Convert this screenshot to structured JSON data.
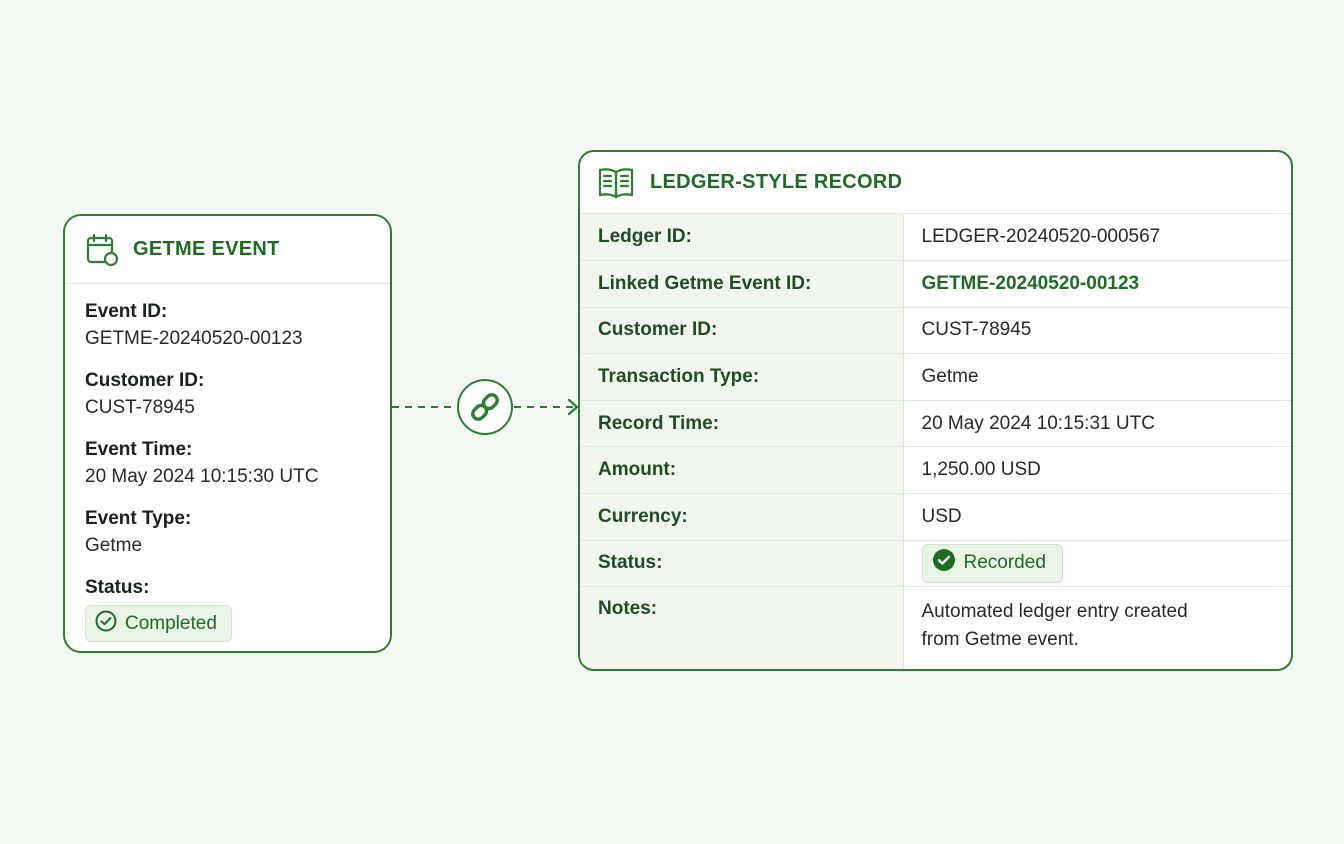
{
  "event_card": {
    "title": "GETME EVENT",
    "icon": "calendar-icon",
    "fields": [
      {
        "label": "Event ID:",
        "value": "GETME-20240520-00123"
      },
      {
        "label": "Customer ID:",
        "value": "CUST-78945"
      },
      {
        "label": "Event Time:",
        "value": "20 May 2024 10:15:30 UTC"
      },
      {
        "label": "Event Type:",
        "value": "Getme"
      }
    ],
    "status": {
      "label": "Status:",
      "value": "Completed",
      "icon": "check-circle-icon"
    }
  },
  "connector": {
    "icon": "link-icon"
  },
  "ledger_card": {
    "title": "LEDGER-STYLE RECORD",
    "icon": "open-book-icon",
    "rows": [
      {
        "label": "Ledger ID:",
        "value": "LEDGER-20240520-000567"
      },
      {
        "label": "Linked Getme Event ID:",
        "value": "GETME-20240520-00123"
      },
      {
        "label": "Customer ID:",
        "value": "CUST-78945"
      },
      {
        "label": "Transaction Type:",
        "value": "Getme"
      },
      {
        "label": "Record Time:",
        "value": "20 May 2024 10:15:31 UTC"
      },
      {
        "label": "Amount:",
        "value": "1,250.00 USD"
      },
      {
        "label": "Currency:",
        "value": "USD"
      }
    ],
    "status": {
      "label": "Status:",
      "value": "Recorded",
      "icon": "check-circle-filled-icon"
    },
    "notes": {
      "label": "Notes:",
      "line1": "Automated ledger entry created",
      "line2": "from Getme event."
    }
  },
  "colors": {
    "accent": "#2e7d32",
    "accent_text": "#1e6b23",
    "background": "#f4f8f2",
    "label_column": "#f1f7ef",
    "badge_background": "#e9f4e6"
  }
}
